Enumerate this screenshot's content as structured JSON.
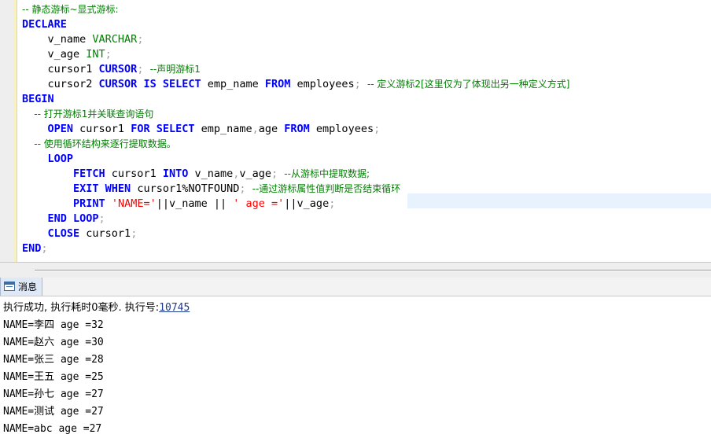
{
  "editor": {
    "lines": [
      [
        {
          "t": "-- 静态游标~显式游标:",
          "c": "cm"
        }
      ],
      [
        {
          "t": "DECLARE",
          "c": "kw"
        }
      ],
      [
        {
          "t": "    v_name ",
          "c": "id"
        },
        {
          "t": "VARCHAR",
          "c": "ty"
        },
        {
          "t": ";",
          "c": "pn"
        }
      ],
      [
        {
          "t": "    v_age ",
          "c": "id"
        },
        {
          "t": "INT",
          "c": "ty"
        },
        {
          "t": ";",
          "c": "pn"
        }
      ],
      [
        {
          "t": "    cursor1 ",
          "c": "id"
        },
        {
          "t": "CURSOR",
          "c": "kw"
        },
        {
          "t": "; ",
          "c": "pn"
        },
        {
          "t": "--声明游标1",
          "c": "cm"
        }
      ],
      [
        {
          "t": "    cursor2 ",
          "c": "id"
        },
        {
          "t": "CURSOR IS SELECT",
          "c": "kw"
        },
        {
          "t": " emp_name ",
          "c": "id"
        },
        {
          "t": "FROM",
          "c": "kw"
        },
        {
          "t": " employees",
          "c": "id"
        },
        {
          "t": "; ",
          "c": "pn"
        },
        {
          "t": "-- 定义游标2[这里仅为了体现出另一种定义方式]",
          "c": "cm"
        }
      ],
      [
        {
          "t": "BEGIN",
          "c": "kw"
        }
      ],
      [
        {
          "t": "    -- 打开游标1并关联查询语句",
          "c": "cm"
        }
      ],
      [
        {
          "t": "    ",
          "c": "id"
        },
        {
          "t": "OPEN",
          "c": "kw"
        },
        {
          "t": " cursor1 ",
          "c": "id"
        },
        {
          "t": "FOR SELECT",
          "c": "kw"
        },
        {
          "t": " emp_name",
          "c": "id"
        },
        {
          "t": ",",
          "c": "pn"
        },
        {
          "t": "age ",
          "c": "id"
        },
        {
          "t": "FROM",
          "c": "kw"
        },
        {
          "t": " employees",
          "c": "id"
        },
        {
          "t": ";",
          "c": "pn"
        }
      ],
      [
        {
          "t": "    -- 使用循环结构来逐行提取数据。",
          "c": "cm"
        }
      ],
      [
        {
          "t": "    ",
          "c": "id"
        },
        {
          "t": "LOOP",
          "c": "kw"
        }
      ],
      [
        {
          "t": "        ",
          "c": "id"
        },
        {
          "t": "FETCH",
          "c": "kw"
        },
        {
          "t": " cursor1 ",
          "c": "id"
        },
        {
          "t": "INTO",
          "c": "kw"
        },
        {
          "t": " v_name",
          "c": "id"
        },
        {
          "t": ",",
          "c": "pn"
        },
        {
          "t": "v_age",
          "c": "id"
        },
        {
          "t": "; ",
          "c": "pn"
        },
        {
          "t": "--从游标中提取数据;",
          "c": "cm"
        }
      ],
      [
        {
          "t": "        ",
          "c": "id"
        },
        {
          "t": "EXIT WHEN",
          "c": "kw"
        },
        {
          "t": " cursor1%NOTFOUND",
          "c": "id"
        },
        {
          "t": "; ",
          "c": "pn"
        },
        {
          "t": "--通过游标属性值判断是否结束循环",
          "c": "cm"
        }
      ],
      [
        {
          "t": "        ",
          "c": "id"
        },
        {
          "t": "PRINT",
          "c": "kw"
        },
        {
          "t": " ",
          "c": "id"
        },
        {
          "t": "'NAME='",
          "c": "st"
        },
        {
          "t": "||v_name || ",
          "c": "id"
        },
        {
          "t": "' age ='",
          "c": "st"
        },
        {
          "t": "||v_age",
          "c": "id"
        },
        {
          "t": ";",
          "c": "pn"
        }
      ],
      [
        {
          "t": "    ",
          "c": "id"
        },
        {
          "t": "END LOOP",
          "c": "kw"
        },
        {
          "t": ";",
          "c": "pn"
        }
      ],
      [
        {
          "t": "    ",
          "c": "id"
        },
        {
          "t": "CLOSE",
          "c": "kw"
        },
        {
          "t": " cursor1",
          "c": "id"
        },
        {
          "t": ";",
          "c": "pn"
        }
      ],
      [
        {
          "t": "END",
          "c": "kw"
        },
        {
          "t": ";",
          "c": "pn"
        }
      ]
    ]
  },
  "result_panel": {
    "tab_label": "消息",
    "status_prefix": "执行成功, 执行耗时0毫秒. 执行号:",
    "execution_id": "10745",
    "rows": [
      "NAME=李四 age =32",
      "NAME=赵六 age =30",
      "NAME=张三 age =28",
      "NAME=王五 age =25",
      "NAME=孙七 age =27",
      "NAME=测试 age =27",
      "NAME=abc age =27"
    ]
  }
}
